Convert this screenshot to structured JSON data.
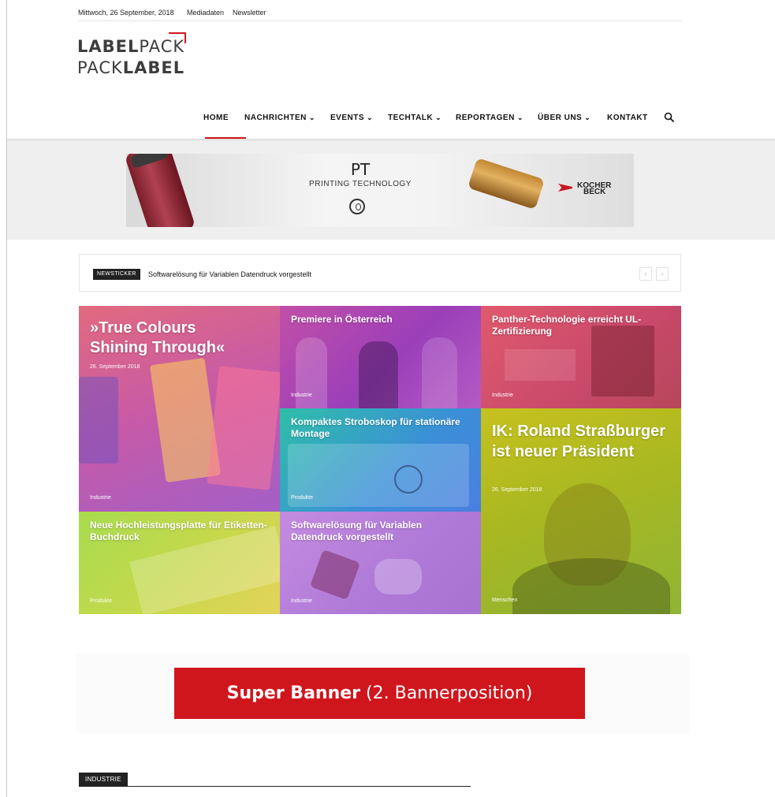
{
  "topbar": {
    "date": "Mittwoch, 26 September, 2018",
    "links": [
      "Mediadaten",
      "Newsletter"
    ]
  },
  "logo": {
    "line1_bold": "LABEL",
    "line1_light": "PACK",
    "line2_light": "PACK",
    "line2_bold": "LABEL"
  },
  "nav": {
    "items": [
      {
        "label": "HOME",
        "active": true,
        "dropdown": false
      },
      {
        "label": "NACHRICHTEN",
        "dropdown": true
      },
      {
        "label": "EVENTS",
        "dropdown": true
      },
      {
        "label": "TECHTALK",
        "dropdown": true
      },
      {
        "label": "REPORTAGEN",
        "dropdown": true
      },
      {
        "label": "ÜBER UNS",
        "dropdown": true
      },
      {
        "label": "KONTAKT",
        "dropdown": false
      }
    ],
    "search_icon": "search-icon"
  },
  "ad": {
    "title": "PT",
    "subtitle": "PRINTING TECHNOLOGY",
    "brand_line1": "KOCHER",
    "brand_line2": "BECK"
  },
  "ticker": {
    "badge": "NEWSTICKER",
    "headline": "Softwarelösung für Variablen Datendruck vorgestellt",
    "prev_icon": "chevron-left-icon",
    "next_icon": "chevron-right-icon"
  },
  "grid": {
    "tiles": [
      {
        "title": "»True Colours Shining Through«",
        "date": "26. September 2018",
        "category": "Industrie",
        "color": "#d45aa8"
      },
      {
        "title": "Premiere in Österreich",
        "category": "Industrie",
        "color": "#b23fb0"
      },
      {
        "title": "Panther-Technologie erreicht UL-Zertifizierung",
        "category": "Industrie",
        "color": "#d8546c"
      },
      {
        "title": "Kompaktes Stroboskop für stationäre Montage",
        "category": "Produkte",
        "color": "#3a8fd9"
      },
      {
        "title": "IK: Roland Straßburger ist neuer Präsident",
        "date": "26. September 2018",
        "category": "Menschen",
        "color": "#a9b821"
      },
      {
        "title": "Neue Hochleistungsplatte für Etiketten-Buchdruck",
        "category": "Produkte",
        "color": "#b5d84a"
      },
      {
        "title": "Softwarelösung für Variablen Datendruck vorgestellt",
        "category": "Industrie",
        "color": "#b87bd8"
      }
    ]
  },
  "super_banner": {
    "bold": "Super Banner",
    "rest": "(2. Bannerposition)"
  },
  "section": {
    "label": "INDUSTRIE"
  }
}
